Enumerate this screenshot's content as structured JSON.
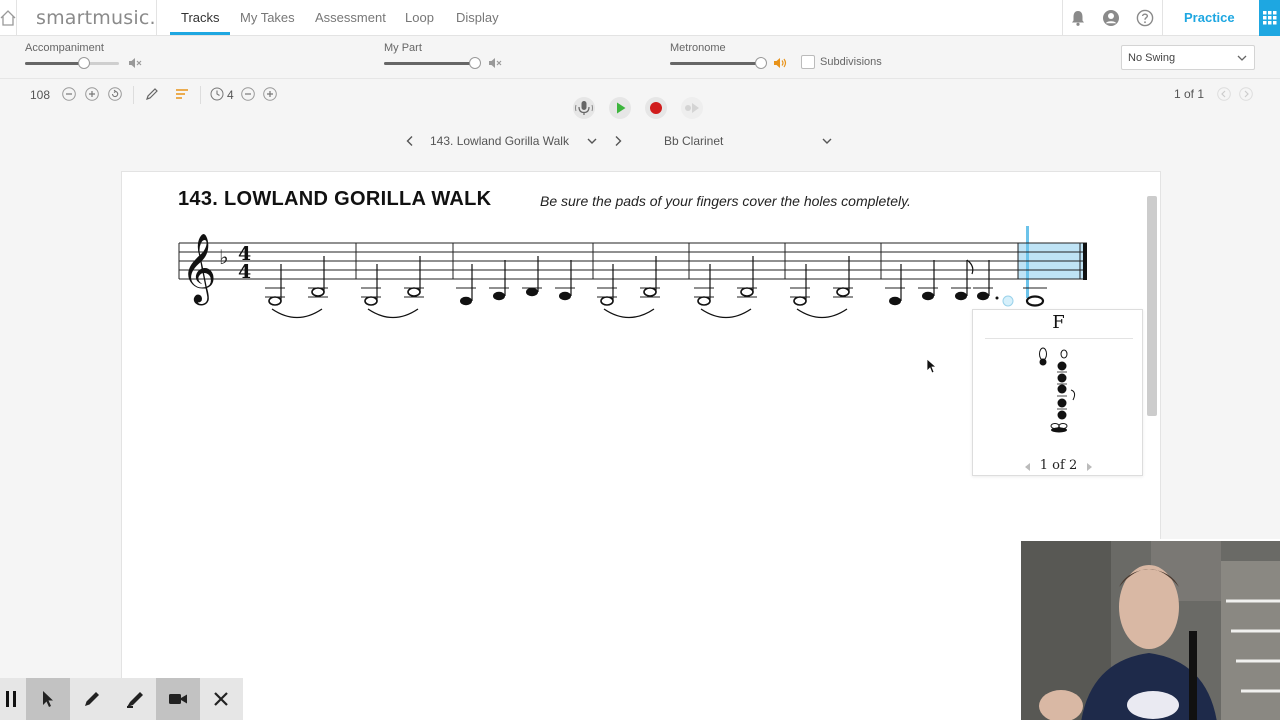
{
  "app": {
    "logo": "smartmusic."
  },
  "nav": {
    "tabs": [
      {
        "label": "Tracks",
        "active": true
      },
      {
        "label": "My Takes"
      },
      {
        "label": "Assessment"
      },
      {
        "label": "Loop"
      },
      {
        "label": "Display"
      }
    ],
    "practice_label": "Practice"
  },
  "mixer": {
    "accompaniment_label": "Accompaniment",
    "accompaniment_level": 0.63,
    "my_part_label": "My Part",
    "my_part_level": 0.97,
    "metronome_label": "Metronome",
    "metronome_level": 0.97,
    "subdivisions_label": "Subdivisions",
    "subdivisions_checked": false,
    "swing_value": "No Swing"
  },
  "tools": {
    "tempo": "108",
    "count_in": "4",
    "page_indicator": "1 of 1"
  },
  "selectors": {
    "song": "143. Lowland Gorilla Walk",
    "instrument": "Bb Clarinet"
  },
  "sheet": {
    "title": "143.  LOWLAND GORILLA WALK",
    "instructions": "Be sure the pads of your fingers cover the holes completely."
  },
  "fingering": {
    "note": "F",
    "page": "1 of 2"
  },
  "colors": {
    "accent": "#1ea7e1",
    "play": "#3db53d",
    "record": "#d01c1c",
    "metronome_on": "#e8931a"
  }
}
